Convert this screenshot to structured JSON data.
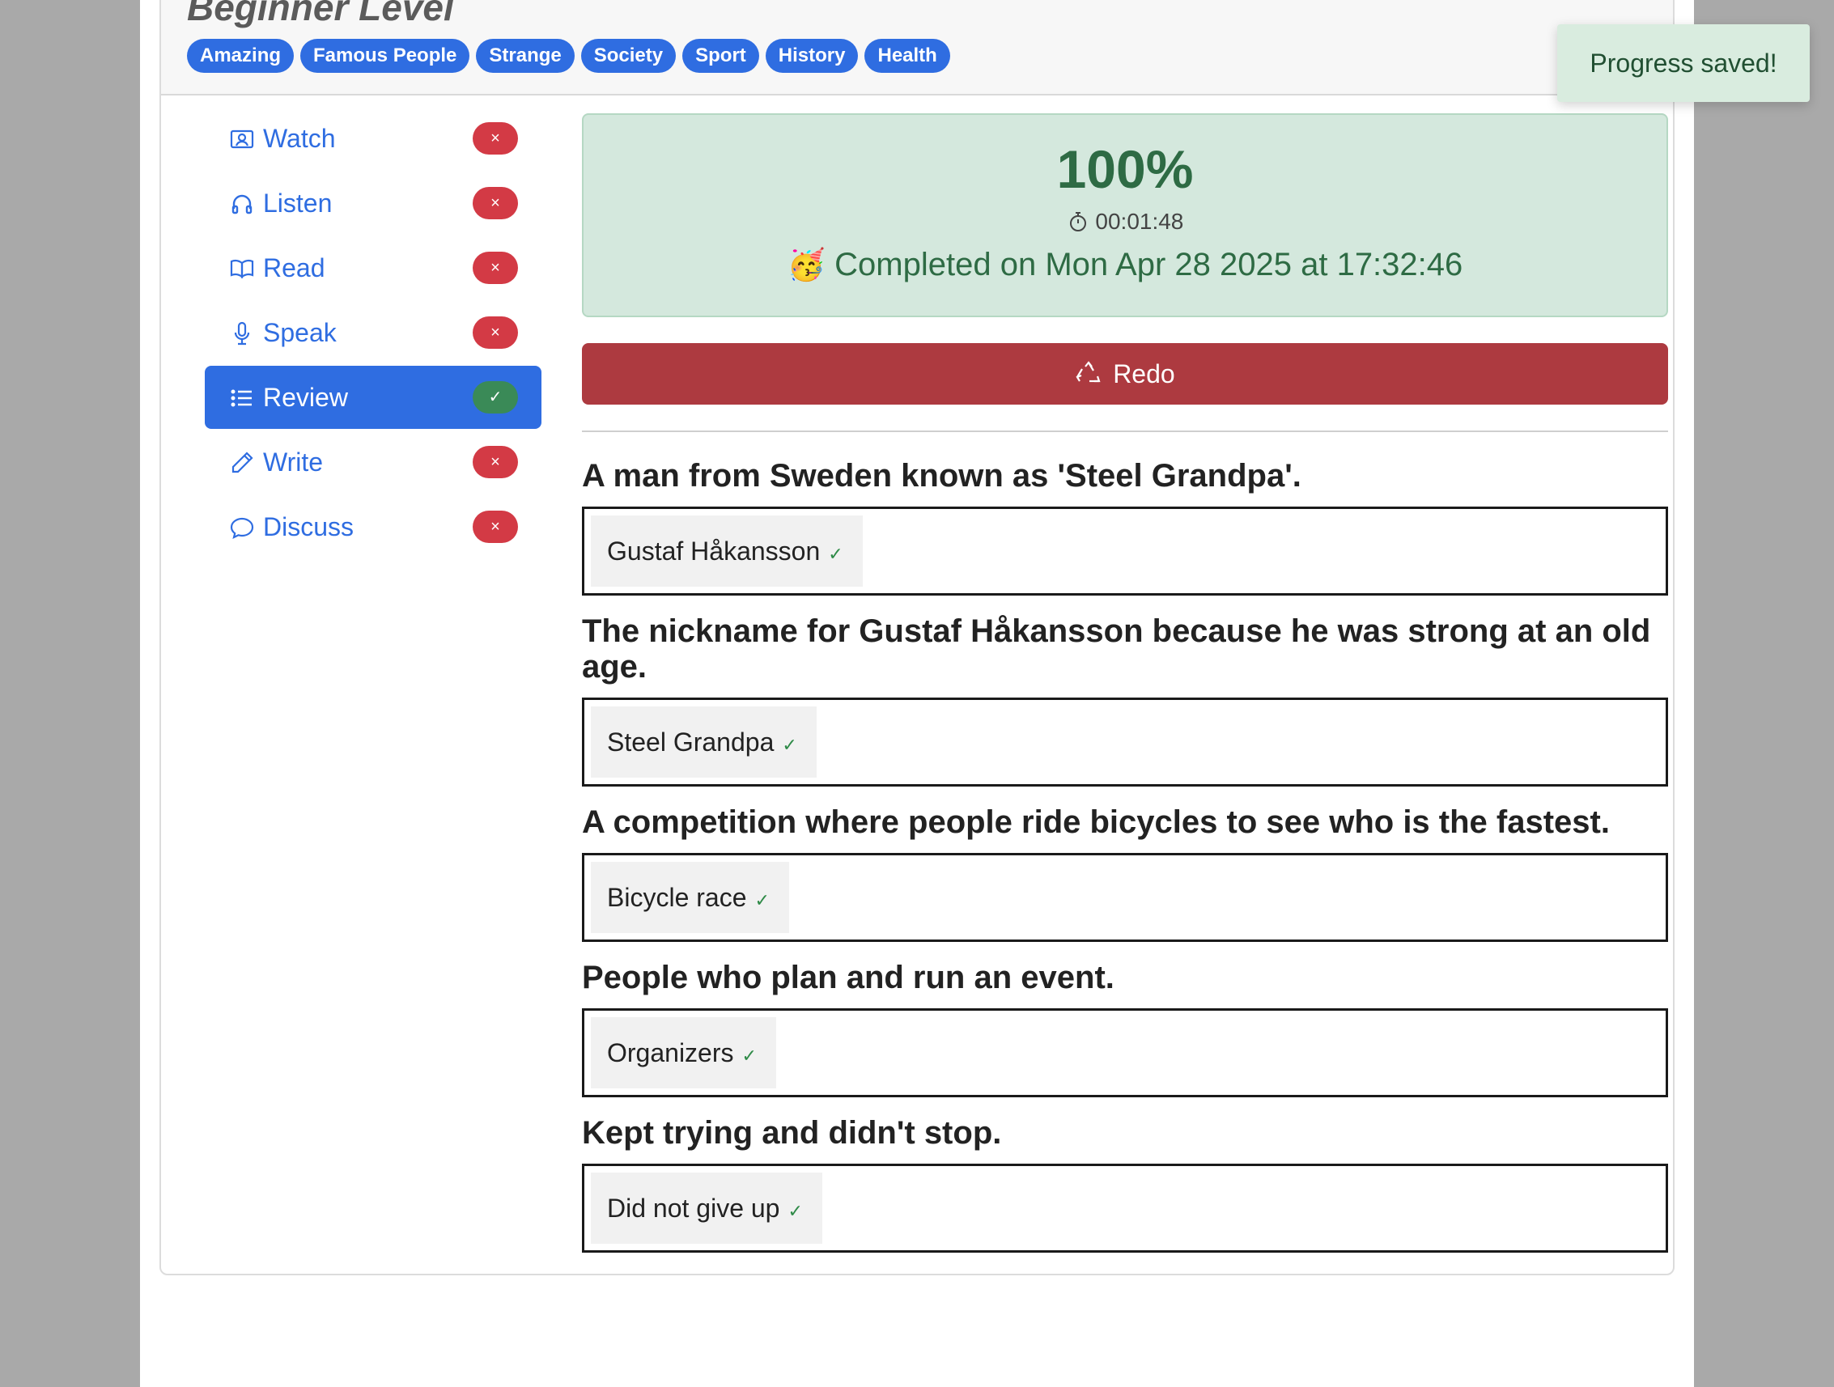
{
  "header": {
    "level_title": "Beginner Level",
    "tags": [
      "Amazing",
      "Famous People",
      "Strange",
      "Society",
      "Sport",
      "History",
      "Health"
    ]
  },
  "sidebar": {
    "items": [
      {
        "label": "Watch",
        "icon": "person-video-icon",
        "status": "×",
        "done": false
      },
      {
        "label": "Listen",
        "icon": "headphones-icon",
        "status": "×",
        "done": false
      },
      {
        "label": "Read",
        "icon": "book-icon",
        "status": "×",
        "done": false
      },
      {
        "label": "Speak",
        "icon": "microphone-icon",
        "status": "×",
        "done": false
      },
      {
        "label": "Review",
        "icon": "list-icon",
        "status": "✓",
        "done": true
      },
      {
        "label": "Write",
        "icon": "pencil-icon",
        "status": "×",
        "done": false
      },
      {
        "label": "Discuss",
        "icon": "chat-bubble-icon",
        "status": "×",
        "done": false
      }
    ]
  },
  "result": {
    "percent": "100%",
    "time": "00:01:48",
    "emoji": "🥳",
    "completed_text": "Completed on Mon Apr 28 2025 at 17:32:46"
  },
  "redo_label": "Redo",
  "questions": [
    {
      "question": "A man from Sweden known as 'Steel Grandpa'.",
      "answer": "Gustaf Håkansson",
      "mark": "✓"
    },
    {
      "question": "The nickname for Gustaf Håkansson because he was strong at an old age.",
      "answer": "Steel Grandpa",
      "mark": "✓"
    },
    {
      "question": "A competition where people ride bicycles to see who is the fastest.",
      "answer": "Bicycle race",
      "mark": "✓"
    },
    {
      "question": "People who plan and run an event.",
      "answer": "Organizers",
      "mark": "✓"
    },
    {
      "question": "Kept trying and didn't stop.",
      "answer": "Did not give up",
      "mark": "✓"
    }
  ],
  "toast": "Progress saved!",
  "colors": {
    "primary": "#2f6de1",
    "danger": "#d33a45",
    "success": "#3a8a57",
    "redo": "#ad3a40",
    "result_bg": "#d4e8dd"
  }
}
